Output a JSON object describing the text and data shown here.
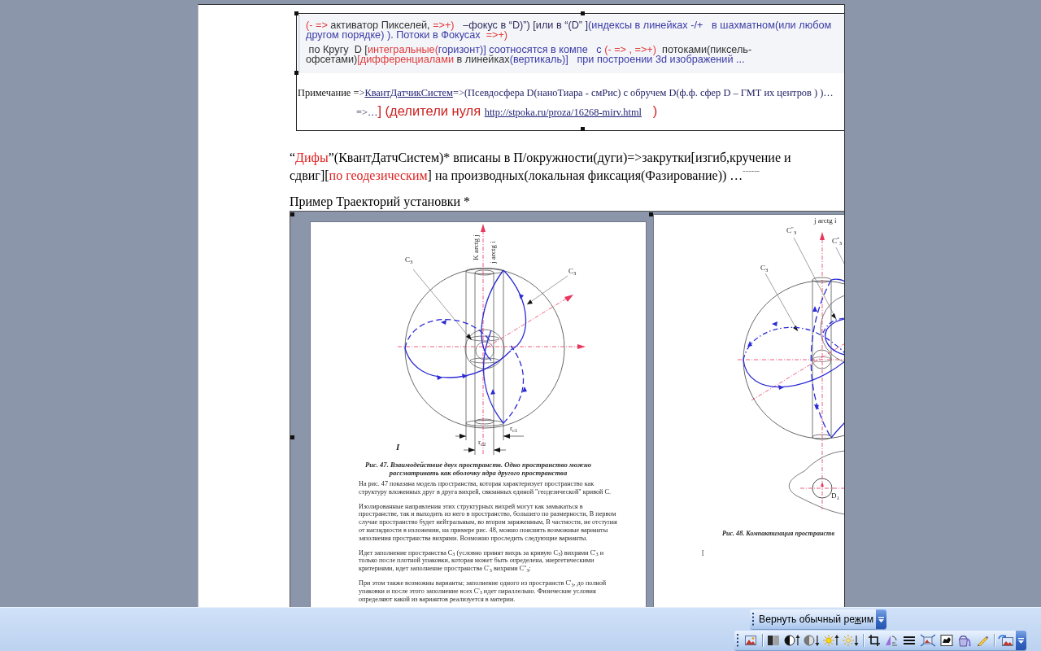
{
  "text_box": {
    "quote_paragraphs": [
      {
        "runs": [
          {
            "text": "(- =>",
            "color": "#e03c3c"
          },
          {
            "text": " активатор Пикселей, ",
            "color": "#333333"
          },
          {
            "text": "=>+)",
            "color": "#e03c3c"
          },
          {
            "text": "   –фокус в “D)”) [или в “(D” ]",
            "color": "#2f2f5f"
          },
          {
            "text": "(индексы в линейках -/+   в шахматном(или любом другом порядке) ). Потоки в Фокусах  ",
            "color": "#3b3ba6"
          },
          {
            "text": "=>+)",
            "color": "#e03c3c"
          }
        ]
      },
      {
        "runs": [
          {
            "text": " по Кругу  D [",
            "color": "#333333"
          },
          {
            "text": "интегральные(",
            "color": "#e03c3c"
          },
          {
            "text": "горизонт)] соотносятся в компе   с ",
            "color": "#3b3ba6"
          },
          {
            "text": "(- => , =>+)",
            "color": "#e03c3c"
          },
          {
            "text": "  потоками(пиксель-офсетами)",
            "color": "#333333"
          },
          {
            "text": "[дифференциалами",
            "color": "#e03c3c"
          },
          {
            "text": " в линейках",
            "color": "#333333"
          },
          {
            "text": "(вертикаль)]   при построении 3d изображений ...",
            "color": "#3b3ba6"
          }
        ]
      }
    ],
    "note_lines": [
      {
        "runs": [
          {
            "text": "Примечание =>",
            "color": "#111111"
          },
          {
            "text": "КвантДатчикСистем",
            "color": "#222277",
            "kind": "link"
          },
          {
            "text": "=>(Псевдосфера D(наноТиара - смРис) с обручем D(ф.ф. сфер D – ГМТ их центров ) )…",
            "color": "#222266"
          }
        ]
      },
      {
        "runs": [
          {
            "text": "=>…"
          },
          {
            "text": "] (делители нуля ",
            "color": "#cc2020",
            "kind": "large"
          },
          {
            "text": "http://stpoka.ru/proza/16268-mirv.html",
            "color": "#222277",
            "kind": "link"
          },
          {
            "text": "   )",
            "color": "#cc2020",
            "kind": "large"
          }
        ]
      }
    ]
  },
  "paragraph": {
    "runs": [
      {
        "text": "“"
      },
      {
        "text": "Дифы",
        "color": "#e02020"
      },
      {
        "text": "”(КвантДатчСистем)* вписаны в П/окружности(дуги)=>закрутки[изгиб,кручение и сдвиг]["
      },
      {
        "text": "по геодезическим",
        "color": "#e02020"
      },
      {
        "text": "] на производных(локальная фиксация(Фазирование)) …"
      },
      {
        "text": "------",
        "kind": "raised"
      }
    ]
  },
  "example_heading": "Пример Траекторий установки *",
  "picture": {
    "pages": [
      {
        "figure_labels": [
          "K arctg j",
          "j arctg i",
          "C$_{3}$",
          "C$_{3}$",
          "r$_{c1}$",
          "r$_{c2}$"
        ],
        "figure_mark": "I",
        "caption": "Рис. 47. Взаимодействие двух пространств. Одно пространство можно рассматривать как оболочку ядра другого пространства",
        "body_paragraphs": [
          "На рис. 47 показана модель пространства, которая характеризует пространство как структуру вложенных друг в друга вихрей, связанных единой \"геодезической\" кривой С.",
          "Изолированные направления этих структурных вихрей могут как замыкаться в пространстве, так и выходить из него в пространство, большего по размерности, В первом случае пространство будет нейтральным, во втором заряженным, В частности, не отступая от наглядности в изложении, на примере рис. 48, можно пояснить возможные варианты заполнения пространства вихрями. Возможно проследить следующие варианты.",
          "Идет заполнение пространства С$_{3}$ (условно принят вихрь за кривую С$_{3}$) вихрями С'$_{3}$ и только после плотной упаковки, которая может быть определена, энергетическими критериями, идет заполнение пространства С'$_{3}$ вихрями С''$_{3}$;",
          "При этом также возможны варианты; заполнение одного из пространств С'$_{3}$, до полной упаковки и после этого заполнение всех С'$_{3}$ идет параллельно. Физические условия определяют какой из вариантов реализуется в материи."
        ]
      },
      {
        "figure_labels": [
          "j arctg i",
          "C$^{″}$$_{3}$",
          "C$^{‴}$$_{3}$",
          "C$_{3}$",
          "D$_{1}$"
        ],
        "caption": "Рис. 48. Компактизация пространств",
        "fragment": "["
      }
    ]
  },
  "mode_toolbar": {
    "button_runs": [
      {
        "text": "Вернуть обычный ре",
        "underline": false
      },
      {
        "text": "ж",
        "underline": true
      },
      {
        "text": "им",
        "underline": false
      }
    ]
  }
}
